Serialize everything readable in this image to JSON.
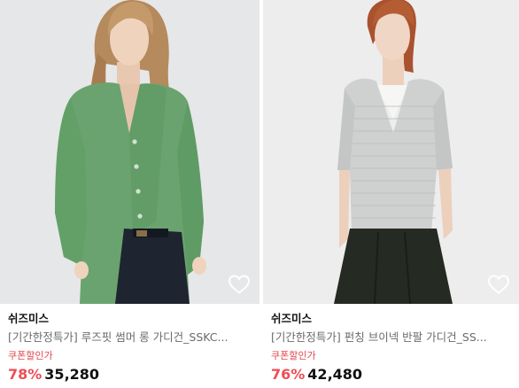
{
  "products": [
    {
      "brand": "쉬즈미스",
      "name": "[기간한정특가] 루즈핏 썸머 롱 가디건_SSKC...",
      "coupon_label": "쿠폰할인가",
      "discount_rate": "78%",
      "price": "35,280",
      "image_icon": "woman-green-cardigan-photo",
      "wishlist_icon": "heart-outline-icon"
    },
    {
      "brand": "쉬즈미스",
      "name": "[기간한정특가] 펀칭 브이넥 반팔 가디건_SS...",
      "coupon_label": "쿠폰할인가",
      "discount_rate": "76%",
      "price": "42,480",
      "image_icon": "woman-gray-knit-cardigan-photo",
      "wishlist_icon": "heart-outline-icon"
    }
  ],
  "colors": {
    "discount": "#ee4d55",
    "coupon": "#e0464b",
    "price": "#111111",
    "name": "#6a6a6a"
  }
}
